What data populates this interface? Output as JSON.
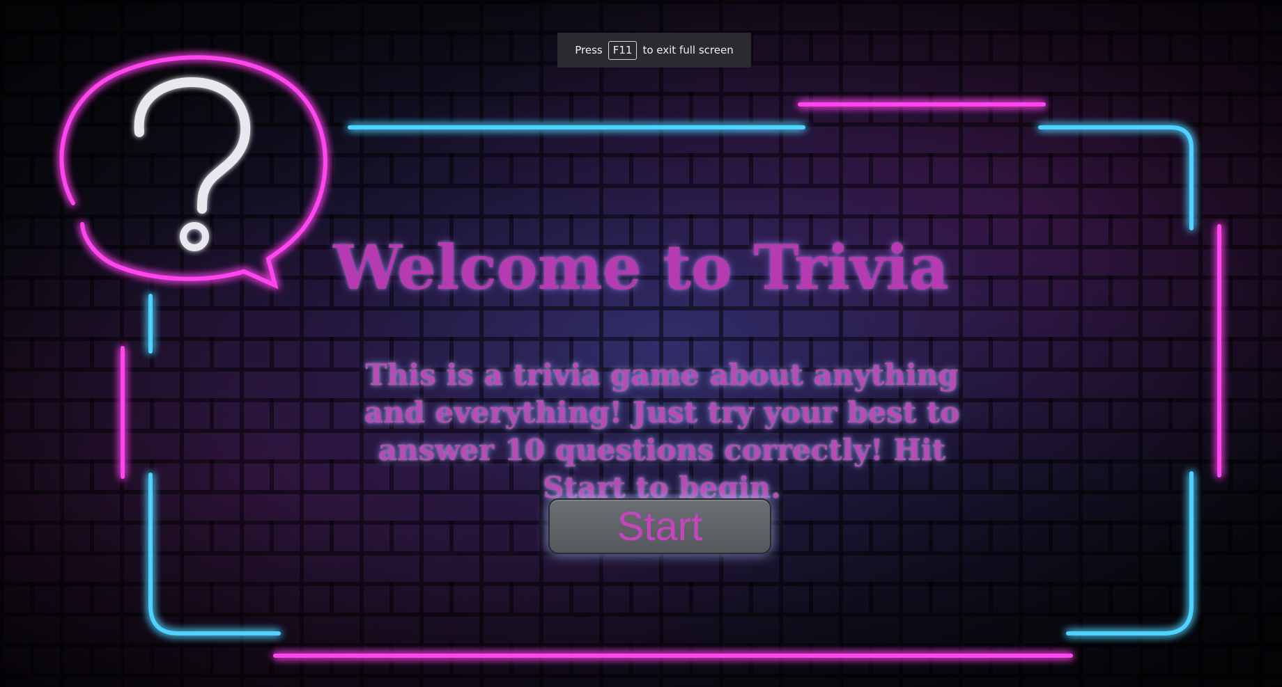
{
  "fullscreen_notice": {
    "prefix": "Press",
    "key": "F11",
    "suffix": "to exit full screen"
  },
  "main": {
    "title": "Welcome to Trivia",
    "description": "This is a trivia game about anything and everything! Just try your best to answer 10 questions correctly! Hit Start to begin.",
    "start_label": "Start"
  },
  "colors": {
    "neon_pink": "#ff3cf0",
    "neon_blue": "#3fc8ff",
    "title_text": "#b63bb0",
    "button_bg": "#5f6267"
  },
  "icons": {
    "question_bubble": "question-speech-bubble-icon"
  }
}
